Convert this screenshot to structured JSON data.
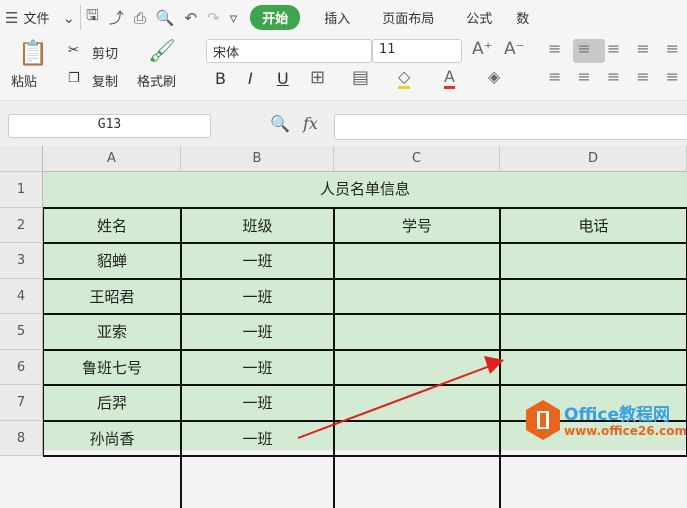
{
  "menubar": {
    "menu": "文件",
    "tabs": [
      "开始",
      "插入",
      "页面布局",
      "公式",
      "数"
    ]
  },
  "ribbon": {
    "paste": "粘贴",
    "cut": "剪切",
    "copy": "复制",
    "format_painter": "格式刷",
    "font": "宋体",
    "size": "11",
    "bold": "B",
    "italic": "I",
    "underline": "U",
    "font_color": "A"
  },
  "formula": {
    "cell_ref": "G13",
    "fx": "fx",
    "value": ""
  },
  "columns": [
    "A",
    "B",
    "C",
    "D"
  ],
  "rows": [
    "1",
    "2",
    "3",
    "4",
    "5",
    "6",
    "7",
    "8"
  ],
  "title": "人员名单信息",
  "headers": [
    "姓名",
    "班级",
    "学号",
    "电话"
  ],
  "data": [
    [
      "貂蝉",
      "一班"
    ],
    [
      "王昭君",
      "一班"
    ],
    [
      "亚索",
      "一班"
    ],
    [
      "鲁班七号",
      "一班"
    ],
    [
      "后羿",
      "一班"
    ],
    [
      "孙尚香",
      "一班"
    ]
  ],
  "watermark": {
    "line1": "Office教程网",
    "line2": "www.office26.com"
  }
}
